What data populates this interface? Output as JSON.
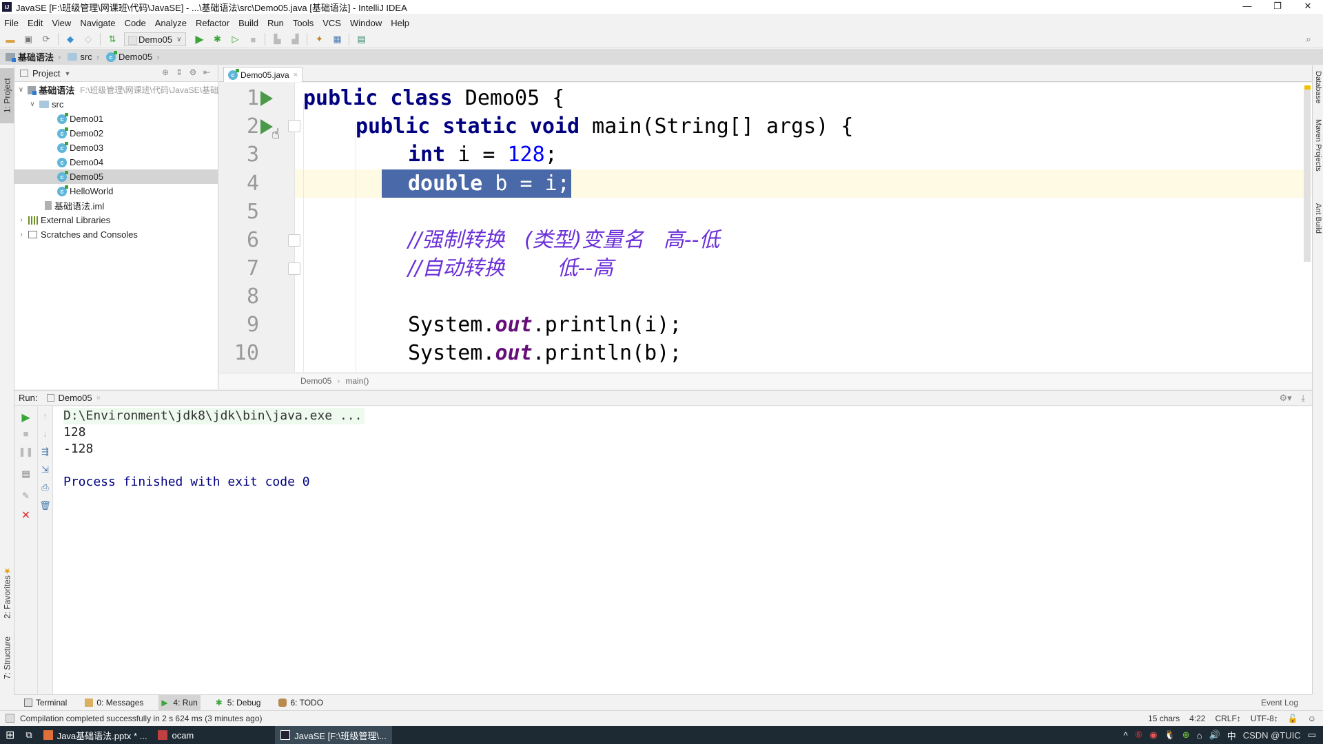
{
  "window": {
    "title": "JavaSE [F:\\班级管理\\网课班\\代码\\JavaSE] - ...\\基础语法\\src\\Demo05.java [基础语法] - IntelliJ IDEA",
    "app_icon": "IJ",
    "controls": {
      "minimize": "—",
      "restore": "❐",
      "close": "✕"
    }
  },
  "menu": [
    "File",
    "Edit",
    "View",
    "Navigate",
    "Code",
    "Analyze",
    "Refactor",
    "Build",
    "Run",
    "Tools",
    "VCS",
    "Window",
    "Help"
  ],
  "toolbar": {
    "run_config": "Demo05",
    "icons": [
      "open-icon",
      "save-icon",
      "sync-icon",
      "back-icon",
      "forward-icon",
      "build-icon",
      "run-icon",
      "debug-icon",
      "coverage-icon",
      "stop-icon",
      "attach-icon",
      "profile-icon",
      "sdk-icon",
      "project-structure-icon",
      "vcs-icon",
      "search-icon"
    ]
  },
  "nav": {
    "crumbs": [
      "基础语法",
      "src",
      "Demo05"
    ]
  },
  "left_strip": {
    "project_tab": "1: Project",
    "favorites_tab": "2: Favorites",
    "structure_tab": "7: Structure"
  },
  "right_strip": {
    "tabs": [
      "Database",
      "Maven Projects",
      "Ant Build"
    ]
  },
  "project": {
    "header": "Project",
    "root": {
      "name": "基础语法",
      "path": "F:\\班级管理\\网课班\\代码\\JavaSE\\基础"
    },
    "src": "src",
    "files": [
      "Demo01",
      "Demo02",
      "Demo03",
      "Demo04",
      "Demo05",
      "HelloWorld"
    ],
    "selected": "Demo05",
    "iml": "基础语法.iml",
    "external_libraries": "External Libraries",
    "scratches": "Scratches and Consoles"
  },
  "editor": {
    "tab": "Demo05.java",
    "current_line": 4,
    "line_numbers": [
      "1",
      "2",
      "3",
      "4",
      "5",
      "6",
      "7",
      "8",
      "9",
      "10"
    ],
    "code": {
      "l1_kw": "public class",
      "l1_rest": " Demo05 {",
      "l2_kw": "public static void",
      "l2_rest": " main(String[] args) {",
      "l3_kw": "int",
      "l3_mid": " i = ",
      "l3_num": "128",
      "l3_end": ";",
      "l4_kw": "double",
      "l4_rest": " b = i;",
      "l6": "//强制转换   (类型)变量名   高--低",
      "l7": "//自动转换        低--高",
      "l9_a": "System.",
      "l9_b": "out",
      "l9_c": ".println(i);",
      "l10_a": "System.",
      "l10_b": "out",
      "l10_c": ".println(b);"
    },
    "breadcrumb": [
      "Demo05",
      "main()"
    ]
  },
  "run": {
    "label": "Run:",
    "tab": "Demo05",
    "console": {
      "command": "D:\\Environment\\jdk8\\jdk\\bin\\java.exe ...",
      "outputs": [
        "128",
        "-128"
      ],
      "finish": "Process finished with exit code 0"
    }
  },
  "bottom_tools": [
    "Terminal",
    "0: Messages",
    "4: Run",
    "5: Debug",
    "6: TODO"
  ],
  "event_log": "Event Log",
  "status": {
    "message": "Compilation completed successfully in 2 s 624 ms (3 minutes ago)",
    "chars": "15 chars",
    "position": "4:22",
    "line_sep": "CRLF↕",
    "encoding": "UTF-8↕"
  },
  "taskbar": {
    "items": [
      "Java基础语法.pptx * ...",
      "ocam",
      "JavaSE [F:\\班级管理\\..."
    ],
    "active": "JavaSE [F:\\班级管理\\...",
    "tray_ime": "中",
    "watermark": "CSDN @TUIC"
  }
}
